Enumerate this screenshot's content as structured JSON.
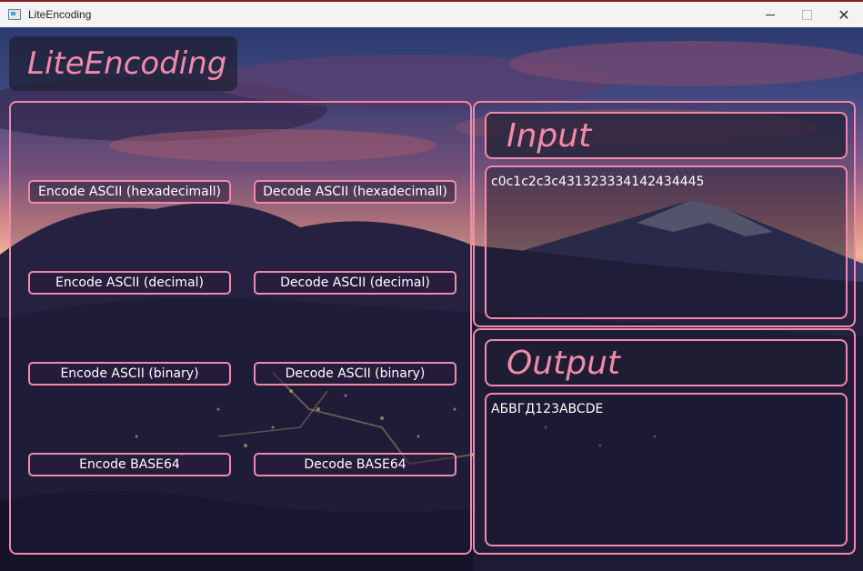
{
  "window": {
    "title": "LiteEncoding",
    "icon": "app-window-icon",
    "controls": [
      "minimize-icon",
      "maximize-icon",
      "close-icon"
    ]
  },
  "app": {
    "logo_text": "LiteEncoding"
  },
  "buttons": {
    "encode_hex": "Encode ASCII (hexadecimall)",
    "decode_hex": "Decode ASCII (hexadecimall)",
    "encode_dec": "Encode ASCII (decimal)",
    "decode_dec": "Decode ASCII (decimal)",
    "encode_bin": "Encode ASCII (binary)",
    "decode_bin": "Decode ASCII (binary)",
    "encode_b64": "Encode BASE64",
    "decode_b64": "Decode BASE64"
  },
  "input": {
    "label": "Input",
    "value": "c0c1c2c3c431323334142434445"
  },
  "output": {
    "label": "Output",
    "value": "АБВГД123ABCDE"
  },
  "colors": {
    "accent": "#f08aa8",
    "text": "#ffffff",
    "panel_bg": "#1e1e32"
  }
}
